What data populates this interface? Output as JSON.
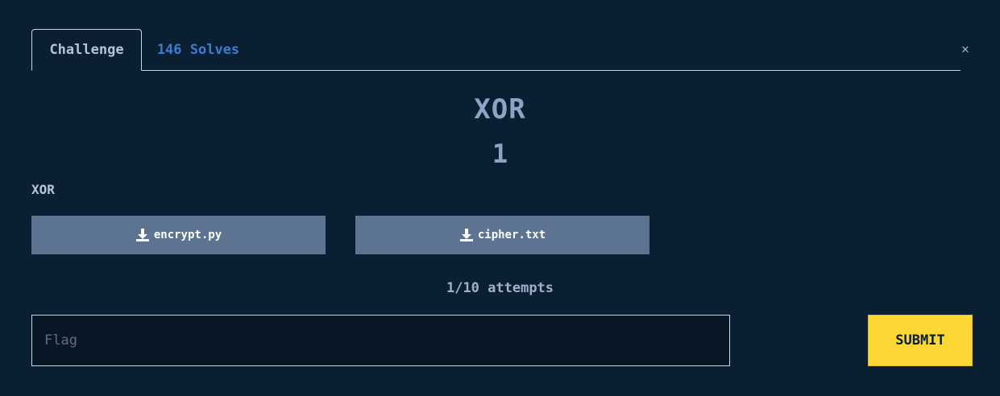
{
  "tabs": {
    "challenge": "Challenge",
    "solves": "146 Solves"
  },
  "close_icon": "close-icon",
  "challenge": {
    "name": "XOR",
    "points": "1",
    "description": "XOR"
  },
  "files": [
    {
      "name": "encrypt.py",
      "icon": "download-icon"
    },
    {
      "name": "cipher.txt",
      "icon": "download-icon"
    }
  ],
  "attempts": "1/10 attempts",
  "flag_input": {
    "placeholder": "Flag",
    "value": ""
  },
  "submit": {
    "label": "SUBMIT"
  },
  "colors": {
    "background": "#0b1f33",
    "file_button": "#5c7491",
    "submit_button": "#fdd835",
    "solves_tab": "#3b7bd0"
  }
}
